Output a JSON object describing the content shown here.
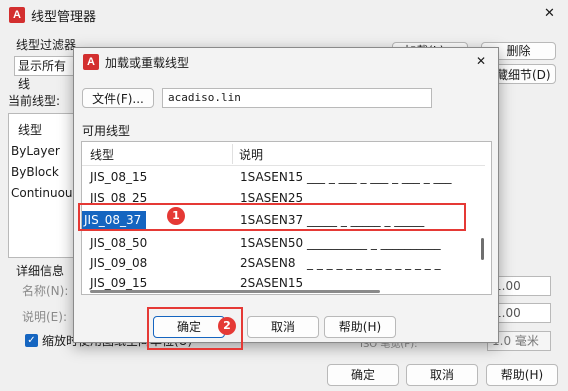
{
  "parent": {
    "title": "线型管理器",
    "close_glyph": "✕",
    "filter_label": "线型过滤器",
    "filter_value": "显示所有线",
    "load_button": "加载(L)...",
    "delete_button": "删除",
    "hide_details_button": "隐藏细节(D)",
    "current_linetype_label": "当前线型:",
    "list_header": "线型",
    "list_items": [
      "ByLayer",
      "ByBlock",
      "Continuous"
    ],
    "details_label": "详细信息",
    "name_label": "名称(N):",
    "desc_label": "说明(E):",
    "scale_checkbox_label": "缩放时使用图纸空间单位(U)",
    "global_scale_value": "1.00",
    "current_scale_value": "1.00",
    "pen_width_label": "ISO 笔宽(P):",
    "pen_width_value": "1.0 毫米",
    "ok_button": "确定",
    "cancel_button": "取消",
    "help_button": "帮助(H)"
  },
  "dialog": {
    "title": "加载或重载线型",
    "close_glyph": "✕",
    "file_button": "文件(F)...",
    "file_value": "acadiso.lin",
    "available_label": "可用线型",
    "col_linetype": "线型",
    "col_description": "说明",
    "rows": [
      {
        "name": "JIS_08_15",
        "code": "1SASEN15",
        "pattern": "___ _ ___ _ ___ _ ___ _ ___"
      },
      {
        "name": "JIS_08_25",
        "code": "1SASEN25",
        "pattern": "____ _ ____ _ ____ _ ____"
      },
      {
        "name": "JIS_08_37",
        "code": "1SASEN37",
        "pattern": "_____ _ _____ _ _____"
      },
      {
        "name": "JIS_08_50",
        "code": "1SASEN50",
        "pattern": "__________ _ __________"
      },
      {
        "name": "JIS_09_08",
        "code": "2SASEN8",
        "pattern": "_ _ _ _ _ _ _ _ _ _ _ _ _ _"
      },
      {
        "name": "JIS_09_15",
        "code": "2SASEN15",
        "pattern": ""
      }
    ],
    "selected_row_index": 2,
    "ok_button": "确定",
    "cancel_button": "取消",
    "help_button": "帮助(H)"
  },
  "annotations": {
    "badge1": "1",
    "badge2": "2"
  },
  "colors": {
    "accent": "#1565c0",
    "annotation_red": "#e53935",
    "selection_blue": "#1565c0"
  },
  "app_icon_glyph": "A"
}
